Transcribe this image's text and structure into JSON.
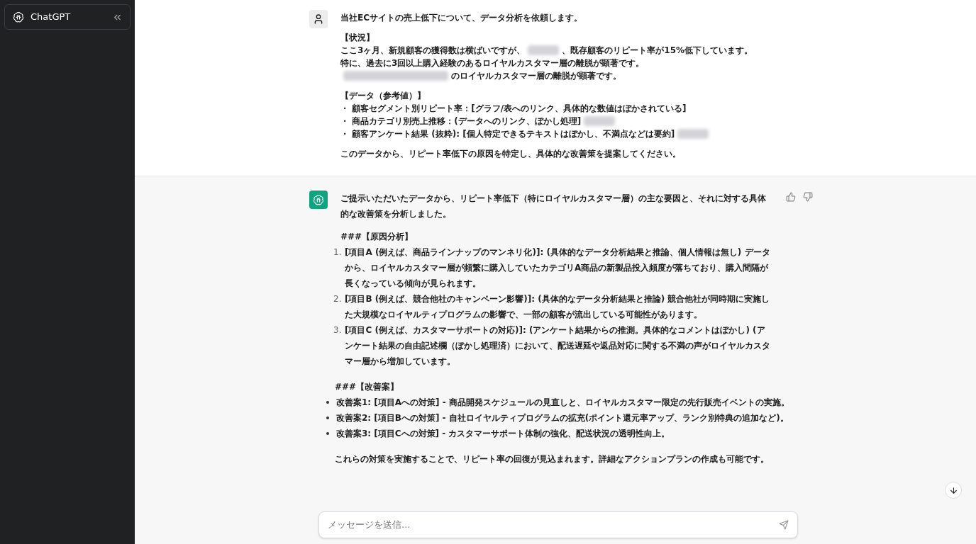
{
  "sidebar": {
    "title": "ChatGPT"
  },
  "user_message": {
    "paragraphs": [
      {
        "lines": [
          [
            {
              "kind": "text",
              "text": "当社ECサイトの売上低下について、データ分析を依頼します。"
            }
          ]
        ]
      },
      {
        "lines": [
          [
            {
              "kind": "text",
              "text": "【状況】"
            }
          ],
          [
            {
              "kind": "text",
              "text": "ここ3ヶ月、新規顧客の獲得数は横ばいですが、"
            },
            {
              "kind": "blur"
            },
            {
              "kind": "text",
              "text": "、既存顧客のリピート率が15%低下しています。"
            }
          ],
          [
            {
              "kind": "text",
              "text": "特に、過去に3回以上購入経験のあるロイヤルカスタマー層の離脱が顕著です。"
            }
          ],
          [
            {
              "kind": "blur",
              "wide": true
            },
            {
              "kind": "text",
              "text": "のロイヤルカスタマー層の離脱が顕著です。"
            }
          ]
        ]
      },
      {
        "lines": [
          [
            {
              "kind": "text",
              "text": "【データ（参考値）】"
            }
          ],
          [
            {
              "kind": "text",
              "text": "・ 顧客セグメント別リピート率：[グラフ/表へのリンク、具体的な数値はぼかされている]"
            }
          ],
          [
            {
              "kind": "text",
              "text": "・ 商品カテゴリ別売上推移：(データへのリンク、ぼかし処理]"
            },
            {
              "kind": "blur"
            }
          ],
          [
            {
              "kind": "text",
              "text": "・ 顧客アンケート結果 (抜粋): [個人特定できるテキストはぼかし、不満点などは要約]"
            },
            {
              "kind": "blur"
            }
          ]
        ]
      },
      {
        "lines": [
          [
            {
              "kind": "text",
              "text": "このデータから、リピート率低下の原因を特定し、具体的な改善策を提案してください。"
            }
          ]
        ]
      }
    ]
  },
  "assistant_message": {
    "intro": "ご提示いただいたデータから、リピート率低下（特にロイヤルカスタマー層）の主な要因と、それに対する具体的な改善策を分析しました。",
    "cause_heading": "###【原因分析】",
    "causes": [
      {
        "number": "1.",
        "text": "[項目A (例えば、商品ラインナップのマンネリ化)]: (具体的なデータ分析結果と推論、個人情報は無し) データから、ロイヤルカスタマー層が頻繁に購入していたカテゴリA商品の新製品投入頻度が落ちており、購入間隔が長くなっている傾向が見られます。"
      },
      {
        "number": "2.",
        "text": "[項目B (例えば、競合他社のキャンペーン影響)]: (具体的なデータ分析結果と推論) 競合他社が同時期に実施した大規模なロイヤルティプログラムの影響で、一部の顧客が流出している可能性があります。"
      },
      {
        "number": "3.",
        "text": "[項目C (例えば、カスタマーサポートの対応)]: (アンケート結果からの推測。具体的なコメントはぼかし) (アンケート結果の自由記述欄（ぼかし処理済）において、配送遅延や返品対応に関する不満の声がロイヤルカスタマー層から増加しています。"
      }
    ],
    "plan_heading": "###【改善案】",
    "plans": [
      "改善案1: [項目Aへの対策] - 商品開発スケジュールの見直しと、ロイヤルカスタマー限定の先行販売イベントの実施。",
      "改善案2: [項目Bへの対策] - 自社ロイヤルティプログラムの拡充(ポイント還元率アップ、ランク別特典の追加など)。",
      "改善案3: [項目Cへの対策] - カスタマーサポート体制の強化、配送状況の透明性向上。"
    ],
    "closing": "これらの対策を実施することで、リピート率の回復が見込まれます。詳細なアクションプランの作成も可能です。"
  },
  "composer": {
    "placeholder": "メッセージを送信..."
  }
}
